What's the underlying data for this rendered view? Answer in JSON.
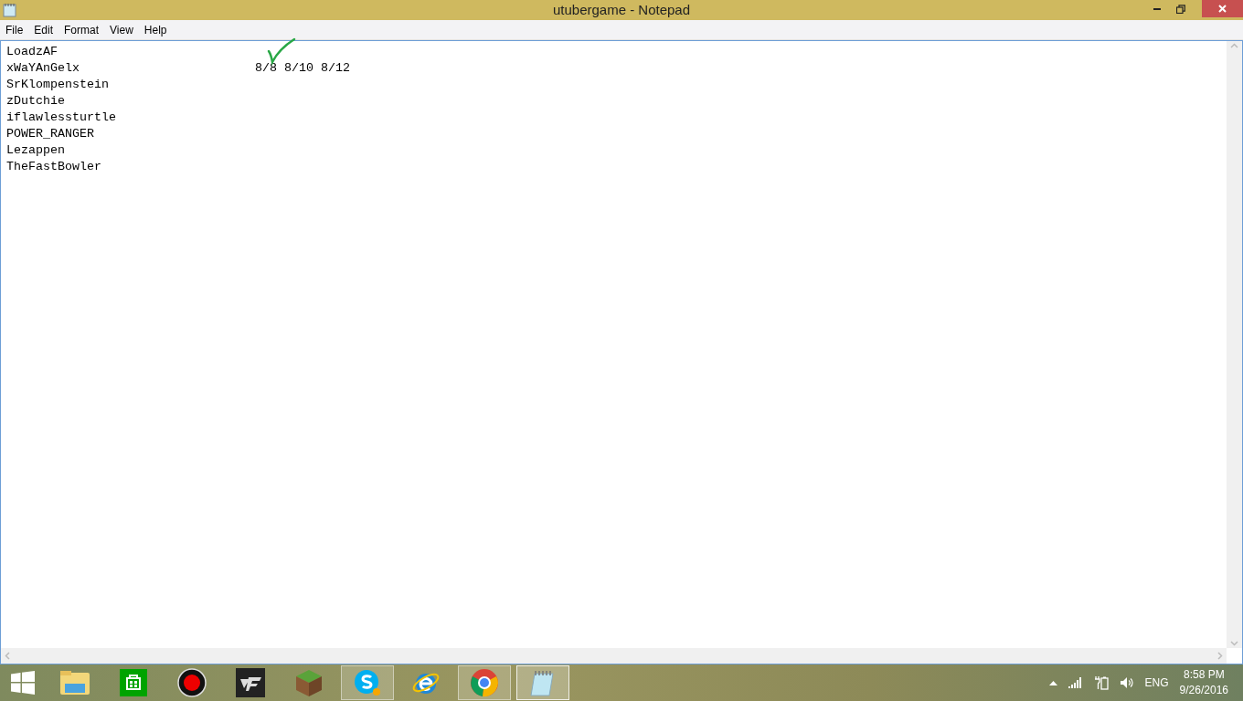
{
  "window": {
    "title": "utubergame - Notepad"
  },
  "menu": [
    "File",
    "Edit",
    "Format",
    "View",
    "Help"
  ],
  "document": {
    "lines": [
      {
        "text": "LoadzAF"
      },
      {
        "text": "xWaYAnGelx",
        "note": "8/8 8/10 8/12",
        "ticked": true
      },
      {
        "text": "SrKlompenstein"
      },
      {
        "text": "zDutchie"
      },
      {
        "text": "iflawlessturtle"
      },
      {
        "text": "POWER_RANGER"
      },
      {
        "text": "Lezappen"
      },
      {
        "text": "TheFastBowler"
      }
    ]
  },
  "taskbar": {
    "apps": [
      {
        "kind": "explorer",
        "running": false,
        "selected": false
      },
      {
        "kind": "store",
        "running": false,
        "selected": false
      },
      {
        "kind": "recorder",
        "running": false,
        "selected": false
      },
      {
        "kind": "crossfire",
        "running": false,
        "selected": false
      },
      {
        "kind": "minecraft",
        "running": false,
        "selected": false
      },
      {
        "kind": "skype",
        "running": true,
        "selected": false
      },
      {
        "kind": "ie",
        "running": false,
        "selected": false
      },
      {
        "kind": "chrome",
        "running": true,
        "selected": false
      },
      {
        "kind": "notepad",
        "running": true,
        "selected": true
      }
    ],
    "language": "ENG",
    "time": "8:58 PM",
    "date": "9/26/2016"
  }
}
